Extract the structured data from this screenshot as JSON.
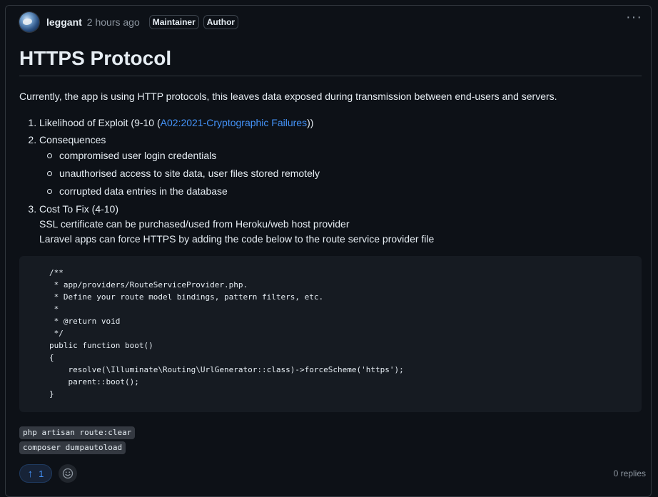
{
  "header": {
    "author": "leggant",
    "time": "2 hours ago",
    "badges": [
      "Maintainer",
      "Author"
    ],
    "more_icon": "kebab-horizontal-icon"
  },
  "post": {
    "title": "HTTPS Protocol",
    "intro": "Currently, the app is using HTTP protocols, this leaves data exposed during transmission between end-users and servers.",
    "items": [
      {
        "prefix": "Likelihood of Exploit (9-10 (",
        "link_text": "A02:2021-Cryptographic Failures",
        "suffix": "))"
      },
      {
        "text": "Consequences",
        "subitems": [
          "compromised user login credentials",
          "unauthorised access to site data, user files stored remotely",
          "corrupted data entries in the database"
        ]
      },
      {
        "text": "Cost To Fix (4-10)",
        "lines": [
          "SSL certificate can be purchased/used from Heroku/web host provider",
          "Laravel apps can force HTTPS by adding the code below to the route service provider file"
        ]
      }
    ],
    "code": "/**\n * app/providers/RouteServiceProvider.php.\n * Define your route model bindings, pattern filters, etc.\n *\n * @return void\n */\npublic function boot()\n{\n    resolve(\\Illuminate\\Routing\\UrlGenerator::class)->forceScheme('https');\n    parent::boot();\n}",
    "inline_commands": [
      "php artisan route:clear",
      "composer dumpautoload"
    ]
  },
  "footer": {
    "upvote_count": "1",
    "replies": "0 replies"
  },
  "colors": {
    "background": "#0d1117",
    "accent": "#4493f8",
    "muted": "#8d96a0",
    "code_bg": "#161b22"
  }
}
